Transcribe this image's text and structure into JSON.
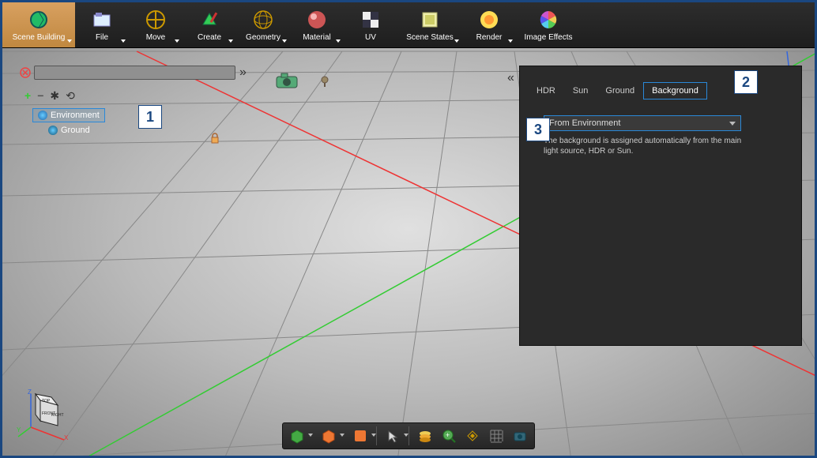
{
  "toolbar": {
    "items": [
      {
        "label": "Scene Building"
      },
      {
        "label": "File"
      },
      {
        "label": "Move"
      },
      {
        "label": "Create"
      },
      {
        "label": "Geometry"
      },
      {
        "label": "Material"
      },
      {
        "label": "UV"
      },
      {
        "label": "Scene States"
      },
      {
        "label": "Render"
      },
      {
        "label": "Image Effects"
      }
    ]
  },
  "scene_tree": {
    "items": [
      {
        "label": "Environment"
      },
      {
        "label": "Ground"
      }
    ]
  },
  "right_panel": {
    "tabs": [
      {
        "label": "HDR"
      },
      {
        "label": "Sun"
      },
      {
        "label": "Ground"
      },
      {
        "label": "Background"
      }
    ],
    "dropdown_value": "From Environment",
    "description": "The background is assigned automatically from the main light source, HDR or Sun."
  },
  "callouts": {
    "c1": "1",
    "c2": "2",
    "c3": "3"
  },
  "cube": {
    "top": "TOP",
    "front": "FRONT",
    "right": "RIGHT"
  },
  "axes": {
    "x": "X",
    "y": "Y",
    "z": "Z"
  }
}
